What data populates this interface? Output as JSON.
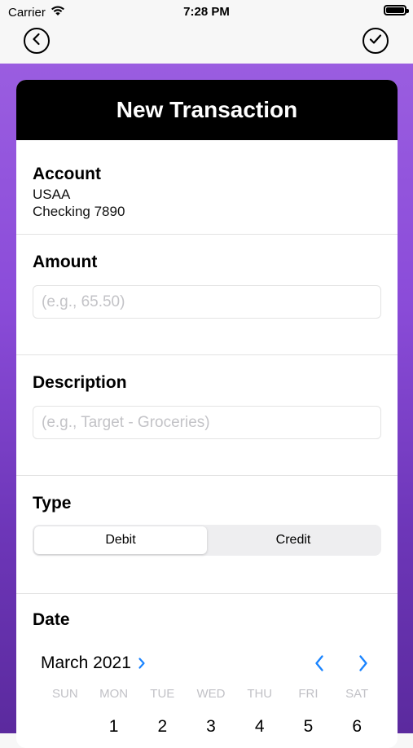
{
  "status_bar": {
    "carrier": "Carrier",
    "time": "7:28 PM"
  },
  "nav": {
    "back_icon": "chevron-left-circle-icon",
    "done_icon": "checkmark-circle-icon"
  },
  "card": {
    "title": "New Transaction"
  },
  "account": {
    "label": "Account",
    "line1": "USAA",
    "line2": "Checking 7890"
  },
  "amount": {
    "label": "Amount",
    "placeholder": "(e.g., 65.50)"
  },
  "description": {
    "label": "Description",
    "placeholder": "(e.g., Target - Groceries)"
  },
  "type": {
    "label": "Type",
    "options": [
      "Debit",
      "Credit"
    ],
    "selected": "Debit"
  },
  "date": {
    "label": "Date",
    "month": "March 2021",
    "weekdays": [
      "SUN",
      "MON",
      "TUE",
      "WED",
      "THU",
      "FRI",
      "SAT"
    ],
    "first_row": [
      "",
      "1",
      "2",
      "3",
      "4",
      "5",
      "6"
    ]
  },
  "colors": {
    "accent": "#1a84ff",
    "header": "#000000",
    "background_top": "#9a5de0",
    "background_bottom": "#5b2a9e"
  }
}
